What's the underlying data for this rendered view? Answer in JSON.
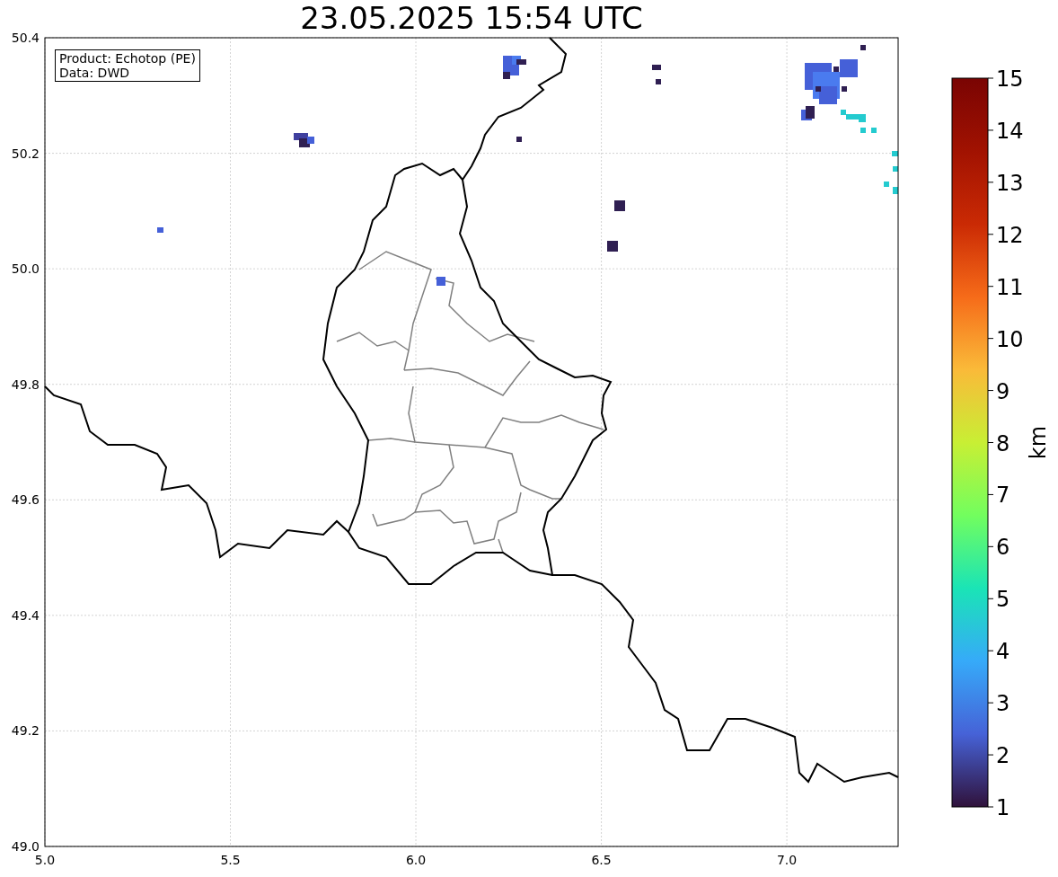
{
  "title": "23.05.2025 15:54 UTC",
  "map": {
    "info_lines": [
      "Product: Echotop (PE)",
      "Data: DWD"
    ],
    "xtick_labels": [
      "5.0",
      "5.5",
      "6.0",
      "6.5",
      "7.0"
    ],
    "ytick_labels": [
      "50.4",
      "50.2",
      "50.0",
      "49.8",
      "49.6",
      "49.4",
      "49.2",
      "49.0"
    ]
  },
  "colorbar": {
    "label": "km",
    "tick_labels": [
      "15",
      "14",
      "13",
      "12",
      "11",
      "10",
      "9",
      "8",
      "7",
      "6",
      "5",
      "4",
      "3",
      "2",
      "1"
    ]
  }
}
